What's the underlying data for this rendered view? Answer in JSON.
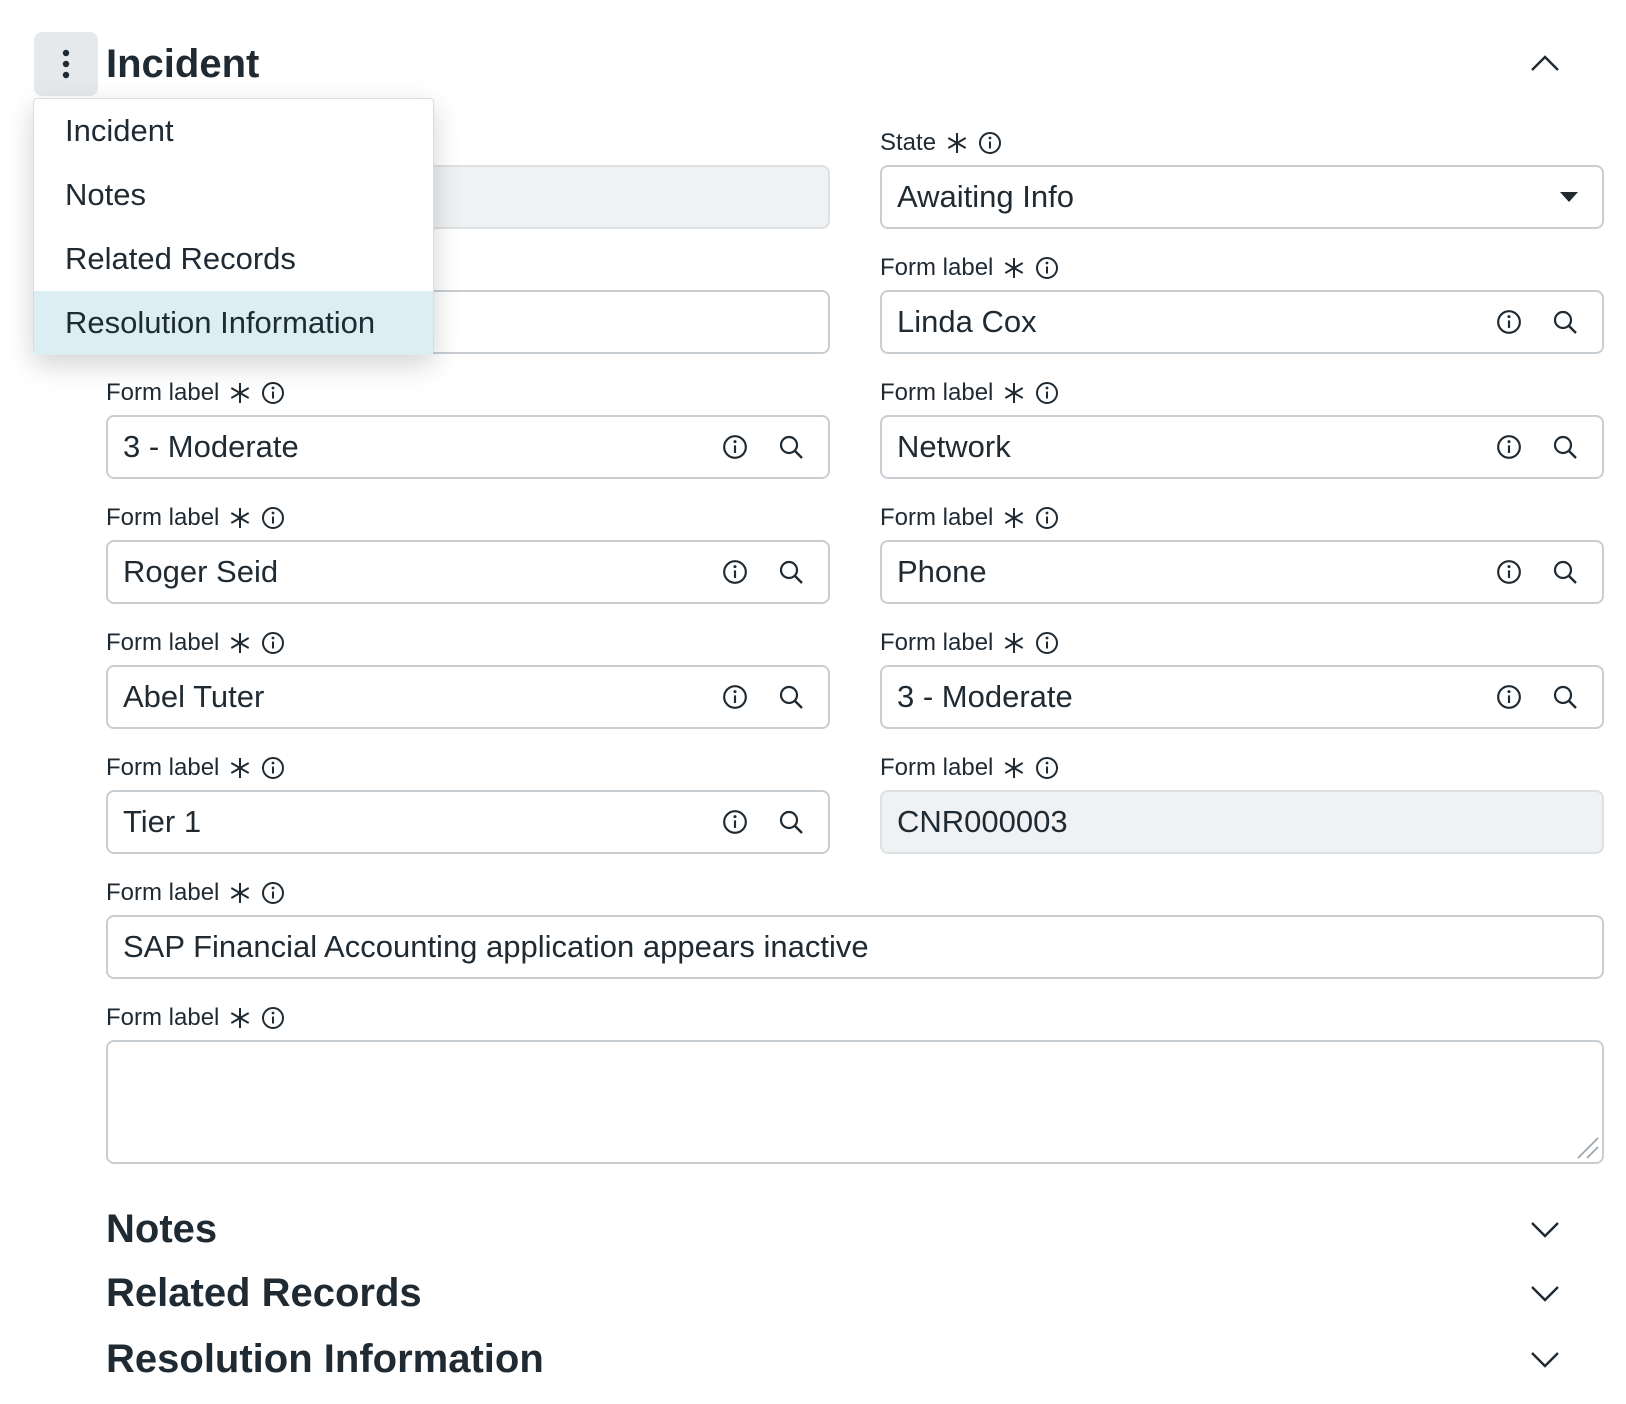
{
  "header": {
    "title": "Incident",
    "menu_button_icon": "kebab-vertical-icon",
    "collapse_icon": "chevron-up-icon"
  },
  "menu": {
    "items": [
      "Incident",
      "Notes",
      "Related Records",
      "Resolution Information"
    ],
    "selected": "Resolution Information"
  },
  "fields": {
    "left_hidden_1": {
      "value": ""
    },
    "left_hidden_2": {
      "value": ""
    },
    "state": {
      "label": "State",
      "value": "Awaiting Info"
    },
    "caller": {
      "label": "Form label",
      "value": "Linda Cox"
    },
    "impact": {
      "label": "Form label",
      "value": "3 - Moderate"
    },
    "category": {
      "label": "Form label",
      "value": "Network"
    },
    "assigned": {
      "label": "Form label",
      "value": "Roger Seid"
    },
    "channel": {
      "label": "Form label",
      "value": "Phone"
    },
    "manager": {
      "label": "Form label",
      "value": "Abel Tuter"
    },
    "urgency": {
      "label": "Form label",
      "value": "3 - Moderate"
    },
    "tier": {
      "label": "Form label",
      "value": "Tier 1"
    },
    "number": {
      "label": "Form label",
      "value": "CNR000003"
    },
    "short_description": {
      "label": "Form label",
      "value": "SAP Financial Accounting application appears inactive"
    },
    "description": {
      "label": "Form label",
      "value": ""
    }
  },
  "sections": {
    "notes": "Notes",
    "related": "Related Records",
    "resolution": "Resolution Information"
  },
  "colors": {
    "text": "#1f2a33",
    "border": "#c9ced3",
    "readonly_bg": "#eff1f2",
    "selected_bg": "#dcedf3"
  }
}
